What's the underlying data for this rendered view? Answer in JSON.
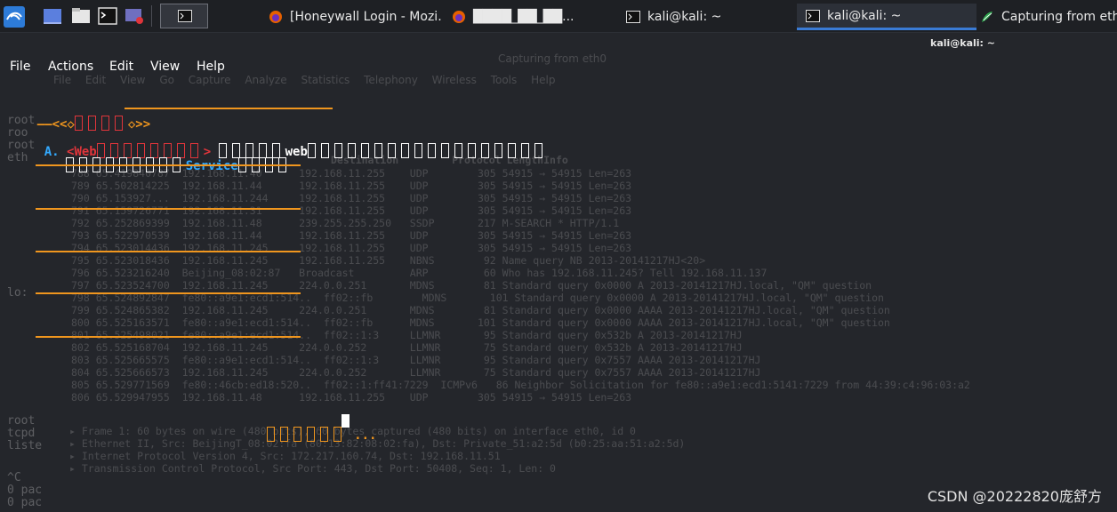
{
  "taskbar": {
    "workspace_button": "",
    "tasks": [
      {
        "label": "[Honeywall Login - Mozi...",
        "icon": "firefox-icon"
      },
      {
        "label": "████_██_██...",
        "icon": "firefox-icon"
      },
      {
        "label": "kali@kali: ~",
        "icon": "terminal-icon"
      },
      {
        "label": "kali@kali: ~",
        "icon": "terminal-icon"
      },
      {
        "label": "Capturing from eth0",
        "icon": "wireshark-icon"
      }
    ]
  },
  "window": {
    "title": "kali@kali: ~"
  },
  "menubar": {
    "items": [
      "File",
      "Actions",
      "Edit",
      "View",
      "Help"
    ]
  },
  "terminal": {
    "header_left": "——<<◇",
    "header_right": "◇>>",
    "line_a_prefix": "A.",
    "line_a_tag": "<Web",
    "line_a_gt": ">",
    "line_a_web": "web",
    "line_b_service": "Service",
    "loading": "...",
    "menu_option_count": 5
  },
  "background_window": {
    "title": "Capturing from eth0",
    "menu": [
      "File",
      "Edit",
      "View",
      "Go",
      "Capture",
      "Analyze",
      "Statistics",
      "Telephony",
      "Wireless",
      "Tools",
      "Help"
    ],
    "columns": [
      "Destination",
      "Protocol",
      "Length",
      "Info"
    ],
    "rows": [
      "788 65.419840787  192.168.11.40      192.168.11.255    UDP        305 54915 → 54915 Len=263",
      "789 65.502814225  192.168.11.44      192.168.11.255    UDP        305 54915 → 54915 Len=263",
      "790 65.153927...  192.168.11.244     192.168.11.255    UDP        305 54915 → 54915 Len=263",
      "791 65.159726771  192.168.11.31      192.168.11.255    UDP        305 54915 → 54915 Len=263",
      "792 65.252869399  192.168.11.48      239.255.255.250   SSDP       217 M-SEARCH * HTTP/1.1",
      "793 65.522970539  192.168.11.44      192.168.11.255    UDP        305 54915 → 54915 Len=263",
      "794 65.523014436  192.168.11.245     192.168.11.255    UDP        305 54915 → 54915 Len=263",
      "795 65.523018436  192.168.11.245     192.168.11.255    NBNS        92 Name query NB 2013-20141217HJ<20>",
      "796 65.523216240  Beijing_08:02:87   Broadcast         ARP         60 Who has 192.168.11.245? Tell 192.168.11.137",
      "797 65.523524700  192.168.11.245     224.0.0.251       MDNS        81 Standard query 0x0000 A 2013-20141217HJ.local, \"QM\" question",
      "798 65.524892847  fe80::a9e1:ecd1:514..  ff02::fb        MDNS       101 Standard query 0x0000 A 2013-20141217HJ.local, \"QM\" question",
      "799 65.524865382  192.168.11.245     224.0.0.251       MDNS        81 Standard query 0x0000 AAAA 2013-20141217HJ.local, \"QM\" question",
      "800 65.525163571  fe80::a9e1:ecd1:514..  ff02::fb      MDNS       101 Standard query 0x0000 AAAA 2013-20141217HJ.local, \"QM\" question",
      "801 65.525498021  fe80::a9e1:ecd1:514..  ff02::1:3     LLMNR       95 Standard query 0x532b A 2013-20141217HJ",
      "802 65.525168704  192.168.11.245     224.0.0.252       LLMNR       75 Standard query 0x532b A 2013-20141217HJ",
      "803 65.525665575  fe80::a9e1:ecd1:514..  ff02::1:3     LLMNR       95 Standard query 0x7557 AAAA 2013-20141217HJ",
      "804 65.525666573  192.168.11.245     224.0.0.252       LLMNR       75 Standard query 0x7557 AAAA 2013-20141217HJ",
      "805 65.529771569  fe80::46cb:ed18:520..  ff02::1:ff41:7229  ICMPv6   86 Neighbor Solicitation for fe80::a9e1:ecd1:5141:7229 from 44:39:c4:96:03:a2",
      "806 65.529947955  192.168.11.48      192.168.11.255    UDP        305 54915 → 54915 Len=263"
    ],
    "details": [
      "▸ Frame 1: 60 bytes on wire (480 bits), 60 bytes captured (480 bits) on interface eth0, id 0",
      "▸ Ethernet II, Src: BeijingT_08:02:fa (80:13:82:08:02:fa), Dst: Private_51:a2:5d (b0:25:aa:51:a2:5d)",
      "▸ Internet Protocol Version 4, Src: 172.217.160.74, Dst: 192.168.11.51",
      "▸ Transmission Control Protocol, Src Port: 443, Dst Port: 50408, Seq: 1, Len: 0"
    ]
  },
  "left_ghost": {
    "top": [
      "root",
      "roo",
      "root",
      "eth"
    ],
    "mid": [
      "lo:"
    ],
    "bottom": [
      "root",
      "tcpd",
      "liste"
    ],
    "footer": [
      "^C",
      "0 pac",
      "0 pac"
    ]
  },
  "watermark": "CSDN @20222820庞舒方",
  "colors": {
    "accent_orange": "#f0961e",
    "red": "#e0353b",
    "blue": "#33aaff",
    "white": "#ffffff"
  }
}
